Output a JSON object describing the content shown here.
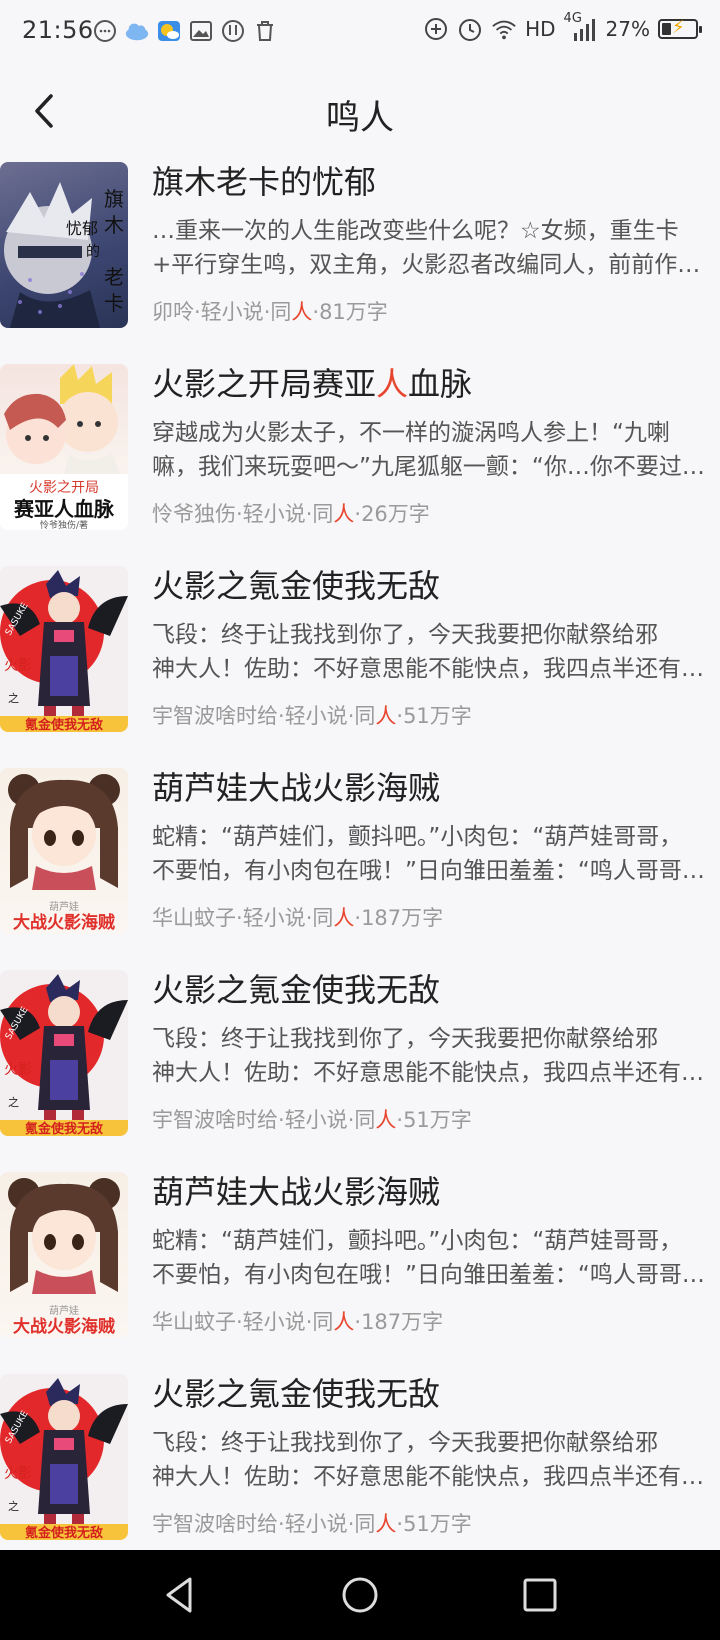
{
  "status_bar": {
    "time": "21:56",
    "network": "HD",
    "signal": "4G",
    "battery_percent": "27%",
    "battery_level": 0.27
  },
  "header": {
    "title": "鸣人",
    "back_icon": "chevron-left-icon"
  },
  "books": [
    {
      "title_parts": [
        "旗木老卡的忧郁",
        "",
        ""
      ],
      "desc": [
        "…重来一次的人生能改变些什么呢？☆女频，重生卡",
        "+平行穿生鸣，双主角，火影忍者改编同人，前前作…"
      ],
      "meta": {
        "author": "卯呤",
        "cat": "轻小说",
        "tag_a": "同",
        "tag_b": "人",
        "words": "81万字"
      },
      "cover_text": [
        "旗",
        "木",
        "老",
        "卡",
        "的",
        "忧郁"
      ]
    },
    {
      "title_parts": [
        "火影之开局赛亚",
        "人",
        "血脉"
      ],
      "desc": [
        "穿越成为火影太子，不一样的漩涡鸣人参上！“九喇",
        "嘛，我们来玩耍吧～”九尾狐躯一颤：“你…你不要过…"
      ],
      "meta": {
        "author": "怜爷独伤",
        "cat": "轻小说",
        "tag_a": "同",
        "tag_b": "人",
        "words": "26万字"
      },
      "cover_text": [
        "火影之开局",
        "赛亚人血脉",
        "怜爷独伤/著"
      ]
    },
    {
      "title_parts": [
        "火影之氪金使我无敌",
        "",
        ""
      ],
      "desc": [
        "飞段：终于让我找到你了，今天我要把你献祭给邪",
        "神大人！佐助：不好意思能不能快点，我四点半还有…"
      ],
      "meta": {
        "author": "宇智波啥时给",
        "cat": "轻小说",
        "tag_a": "同",
        "tag_b": "人",
        "words": "51万字"
      },
      "cover_text": [
        "氪金使我无敌",
        "火影",
        "之",
        "SASUKE"
      ]
    },
    {
      "title_parts": [
        "葫芦娃大战火影海贼",
        "",
        ""
      ],
      "desc": [
        "蛇精：“葫芦娃们，颤抖吧。”小肉包：“葫芦娃哥哥，",
        "不要怕，有小肉包在哦！”日向雏田羞羞：“鸣人哥哥…"
      ],
      "meta": {
        "author": "华山蚊子",
        "cat": "轻小说",
        "tag_a": "同",
        "tag_b": "人",
        "words": "187万字"
      },
      "cover_text": [
        "大战火影海贼",
        "葫芦娃"
      ]
    },
    {
      "title_parts": [
        "火影之氪金使我无敌",
        "",
        ""
      ],
      "desc": [
        "飞段：终于让我找到你了，今天我要把你献祭给邪",
        "神大人！佐助：不好意思能不能快点，我四点半还有…"
      ],
      "meta": {
        "author": "宇智波啥时给",
        "cat": "轻小说",
        "tag_a": "同",
        "tag_b": "人",
        "words": "51万字"
      },
      "cover_text": [
        "氪金使我无敌",
        "火影",
        "之",
        "SASUKE"
      ]
    },
    {
      "title_parts": [
        "葫芦娃大战火影海贼",
        "",
        ""
      ],
      "desc": [
        "蛇精：“葫芦娃们，颤抖吧。”小肉包：“葫芦娃哥哥，",
        "不要怕，有小肉包在哦！”日向雏田羞羞：“鸣人哥哥…"
      ],
      "meta": {
        "author": "华山蚊子",
        "cat": "轻小说",
        "tag_a": "同",
        "tag_b": "人",
        "words": "187万字"
      },
      "cover_text": [
        "大战火影海贼",
        "葫芦娃"
      ]
    },
    {
      "title_parts": [
        "火影之氪金使我无敌",
        "",
        ""
      ],
      "desc": [
        "飞段：终于让我找到你了，今天我要把你献祭给邪",
        "神大人！佐助：不好意思能不能快点，我四点半还有…"
      ],
      "meta": {
        "author": "宇智波啥时给",
        "cat": "轻小说",
        "tag_a": "同",
        "tag_b": "人",
        "words": "51万字"
      },
      "cover_text": [
        "氪金使我无敌",
        "火影",
        "之",
        "SASUKE"
      ]
    }
  ],
  "nav_bar": {
    "back": "triangle-back-icon",
    "home": "circle-home-icon",
    "recents": "square-recents-icon"
  },
  "colors": {
    "highlight": "#e8452e",
    "meta_text": "#9a9a9a",
    "background": "#f7f6f8"
  }
}
